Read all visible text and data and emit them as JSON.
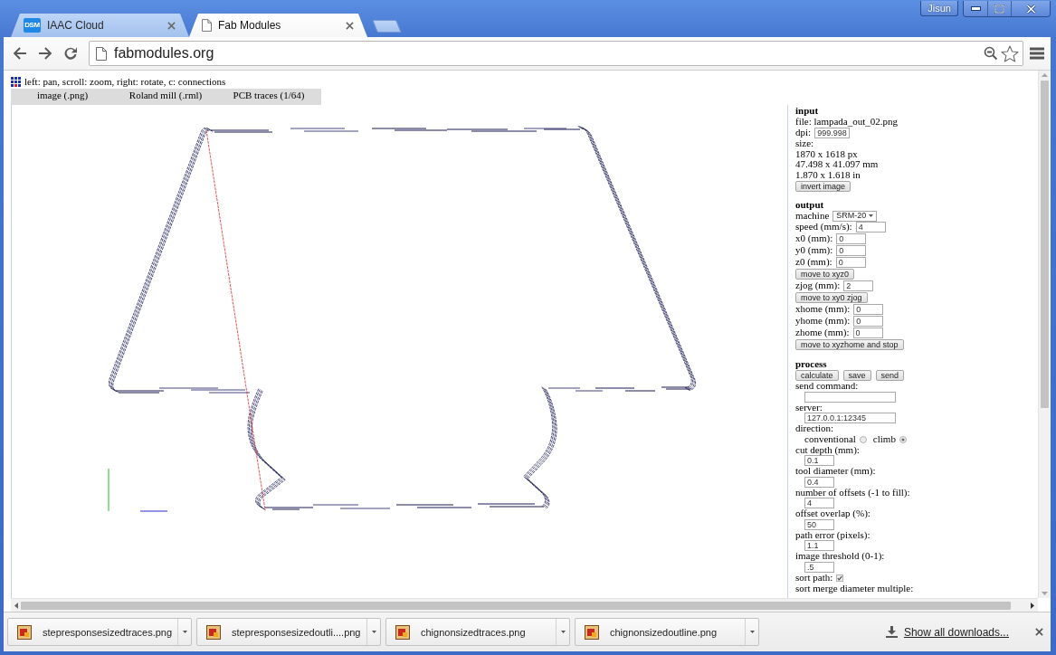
{
  "window": {
    "profile": "Jisun"
  },
  "tabs": [
    {
      "kind": "logo",
      "logo_text": "DSM",
      "title": "IAAC Cloud",
      "selected": false
    },
    {
      "kind": "page",
      "title": "Fab Modules",
      "selected": true
    }
  ],
  "address_bar": {
    "url": "fabmodules.org"
  },
  "page": {
    "hint": "left: pan, scroll: zoom, right: rotate, c: connections",
    "module_tabs": [
      "image (.png)",
      "Roland mill (.rml)",
      "PCB traces (1/64)"
    ]
  },
  "panel": {
    "sections": [
      {
        "title": "input",
        "items": [
          {
            "kind": "text",
            "text": "file: lampada_out_02.png"
          },
          {
            "kind": "inline_field",
            "label": "dpi:",
            "value": "999.998"
          },
          {
            "kind": "text",
            "text": "size:"
          },
          {
            "kind": "text",
            "text": "1870 x 1618 px"
          },
          {
            "kind": "text",
            "text": "47.498 x 41.097 mm"
          },
          {
            "kind": "text",
            "text": "1.870 x 1.618 in"
          },
          {
            "kind": "buttons",
            "labels": [
              "invert image"
            ]
          }
        ]
      },
      {
        "title": "output",
        "items": [
          {
            "kind": "select",
            "label": "machine",
            "value": "SRM-20"
          },
          {
            "kind": "inline_field",
            "label": "speed (mm/s):",
            "value": "4"
          },
          {
            "kind": "inline_field",
            "label": "x0 (mm):",
            "value": "0"
          },
          {
            "kind": "inline_field",
            "label": "y0 (mm):",
            "value": "0"
          },
          {
            "kind": "inline_field",
            "label": "z0 (mm):",
            "value": "0"
          },
          {
            "kind": "buttons",
            "labels": [
              "move to xyz0"
            ]
          },
          {
            "kind": "inline_field",
            "label": "zjog (mm):",
            "value": "2"
          },
          {
            "kind": "buttons",
            "labels": [
              "move to xy0 zjog"
            ]
          },
          {
            "kind": "inline_field",
            "label": "xhome (mm):",
            "value": "0"
          },
          {
            "kind": "inline_field",
            "label": "yhome (mm):",
            "value": "0"
          },
          {
            "kind": "inline_field",
            "label": "zhome (mm):",
            "value": "0"
          },
          {
            "kind": "buttons",
            "labels": [
              "move to xyzhome and stop"
            ]
          }
        ]
      },
      {
        "title": "process",
        "items": [
          {
            "kind": "buttons",
            "labels": [
              "calculate",
              "save",
              "send"
            ]
          },
          {
            "kind": "wide_field",
            "label": "send command:"
          },
          {
            "kind": "wide_field",
            "label": "server:",
            "value": "127.0.0.1:12345"
          },
          {
            "kind": "radios",
            "label": "direction:",
            "options": [
              {
                "label": "conventional",
                "selected": false
              },
              {
                "label": "climb",
                "selected": true
              }
            ]
          },
          {
            "kind": "stacked_field",
            "label": "cut depth (mm):",
            "value": "0.1"
          },
          {
            "kind": "stacked_field",
            "label": "tool diameter (mm):",
            "value": "0.4"
          },
          {
            "kind": "stacked_field",
            "label": "number of offsets (-1 to fill):",
            "value": "4"
          },
          {
            "kind": "stacked_field",
            "label": "offset overlap (%):",
            "value": "50"
          },
          {
            "kind": "stacked_field",
            "label": "path error (pixels):",
            "value": "1.1"
          },
          {
            "kind": "stacked_field",
            "label": "image threshold (0-1):",
            "value": ".5"
          },
          {
            "kind": "checkbox",
            "label": "sort path:",
            "checked": true
          },
          {
            "kind": "text",
            "text": "sort merge diameter multiple:"
          }
        ]
      }
    ]
  },
  "downloads": {
    "files": [
      "stepresponsesizedtraces.png",
      "stepresponsesizedoutli....png",
      "chignonsizedtraces.png",
      "chignonsizedoutline.png"
    ],
    "show_all": "Show all downloads..."
  }
}
